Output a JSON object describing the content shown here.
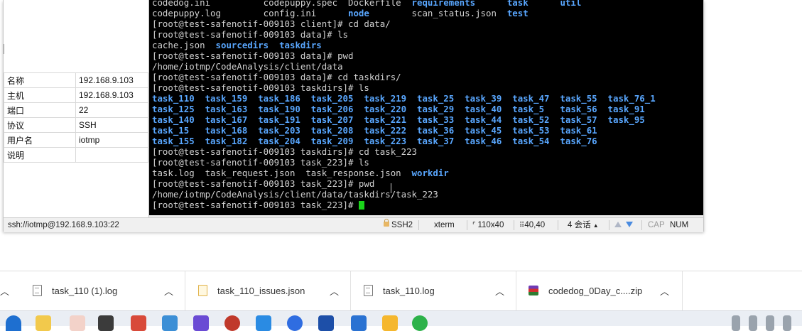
{
  "properties": [
    {
      "key": "名称",
      "value": "192.168.9.103"
    },
    {
      "key": "主机",
      "value": "192.168.9.103"
    },
    {
      "key": "端口",
      "value": "22"
    },
    {
      "key": "协议",
      "value": "SSH"
    },
    {
      "key": "用户名",
      "value": "iotmp"
    },
    {
      "key": "说明",
      "value": ""
    }
  ],
  "terminal": {
    "lines": [
      [
        {
          "t": "codedog.ini          "
        },
        {
          "t": "codepuppy.spec  "
        },
        {
          "t": "Dockerfile  "
        },
        {
          "t": "requirements",
          "c": "blue"
        },
        {
          "t": "      "
        },
        {
          "t": "task",
          "c": "blue"
        },
        {
          "t": "      "
        },
        {
          "t": "util",
          "c": "blue"
        }
      ],
      [
        {
          "t": "codepuppy.log        "
        },
        {
          "t": "config.ini      "
        },
        {
          "t": "node",
          "c": "blue"
        },
        {
          "t": "        "
        },
        {
          "t": "scan_status.json  "
        },
        {
          "t": "test",
          "c": "blue"
        }
      ],
      [
        {
          "t": "[root@test-safenotif-009103 client]# cd data/"
        }
      ],
      [
        {
          "t": "[root@test-safenotif-009103 data]# ls"
        }
      ],
      [
        {
          "t": "cache.json  "
        },
        {
          "t": "sourcedirs",
          "c": "blue"
        },
        {
          "t": "  "
        },
        {
          "t": "taskdirs",
          "c": "blue"
        }
      ],
      [
        {
          "t": "[root@test-safenotif-009103 data]# pwd"
        }
      ],
      [
        {
          "t": "/home/iotmp/CodeAnalysis/client/data"
        }
      ],
      [
        {
          "t": "[root@test-safenotif-009103 data]# cd taskdirs/"
        }
      ],
      [
        {
          "t": "[root@test-safenotif-009103 taskdirs]# ls"
        }
      ],
      [
        {
          "t": "task_110  task_159  task_186  task_205  task_219  task_25  task_39  task_47  task_55  task_76_1",
          "c": "blue"
        }
      ],
      [
        {
          "t": "task_125  task_163  task_190  task_206  task_220  task_29  task_40  task_5   task_56  task_91",
          "c": "blue"
        }
      ],
      [
        {
          "t": "task_140  task_167  task_191  task_207  task_221  task_33  task_44  task_52  task_57  task_95",
          "c": "blue"
        }
      ],
      [
        {
          "t": "task_15   task_168  task_203  task_208  task_222  task_36  task_45  task_53  task_61",
          "c": "blue"
        }
      ],
      [
        {
          "t": "task_155  task_182  task_204  task_209  task_223  task_37  task_46  task_54  task_76",
          "c": "blue"
        }
      ],
      [
        {
          "t": "[root@test-safenotif-009103 taskdirs]# cd task_223"
        }
      ],
      [
        {
          "t": "[root@test-safenotif-009103 task_223]# ls"
        }
      ],
      [
        {
          "t": "task.log  task_request.json  task_response.json  "
        },
        {
          "t": "workdir",
          "c": "blue"
        }
      ],
      [
        {
          "t": "[root@test-safenotif-009103 task_223]# pwd"
        }
      ],
      [
        {
          "t": "/home/iotmp/CodeAnalysis/client/data/taskdirs/task_223"
        }
      ],
      [
        {
          "t": "[root@test-safenotif-009103 task_223]# "
        }
      ]
    ]
  },
  "status": {
    "connection": "ssh://iotmp@192.168.9.103:22",
    "protocol": "SSH2",
    "term": "xterm",
    "size": "110x40",
    "cursor_pos": "40,40",
    "sessions": "4 会话",
    "cap": "CAP",
    "num": "NUM"
  },
  "downloads": [
    {
      "name": "task_110 (1).log",
      "icon": "file-icon"
    },
    {
      "name": "task_110_issues.json",
      "icon": "json-file-icon"
    },
    {
      "name": "task_110.log",
      "icon": "file-icon"
    },
    {
      "name": "codedog_0Day_c....zip",
      "icon": "zip-archive-icon"
    }
  ]
}
